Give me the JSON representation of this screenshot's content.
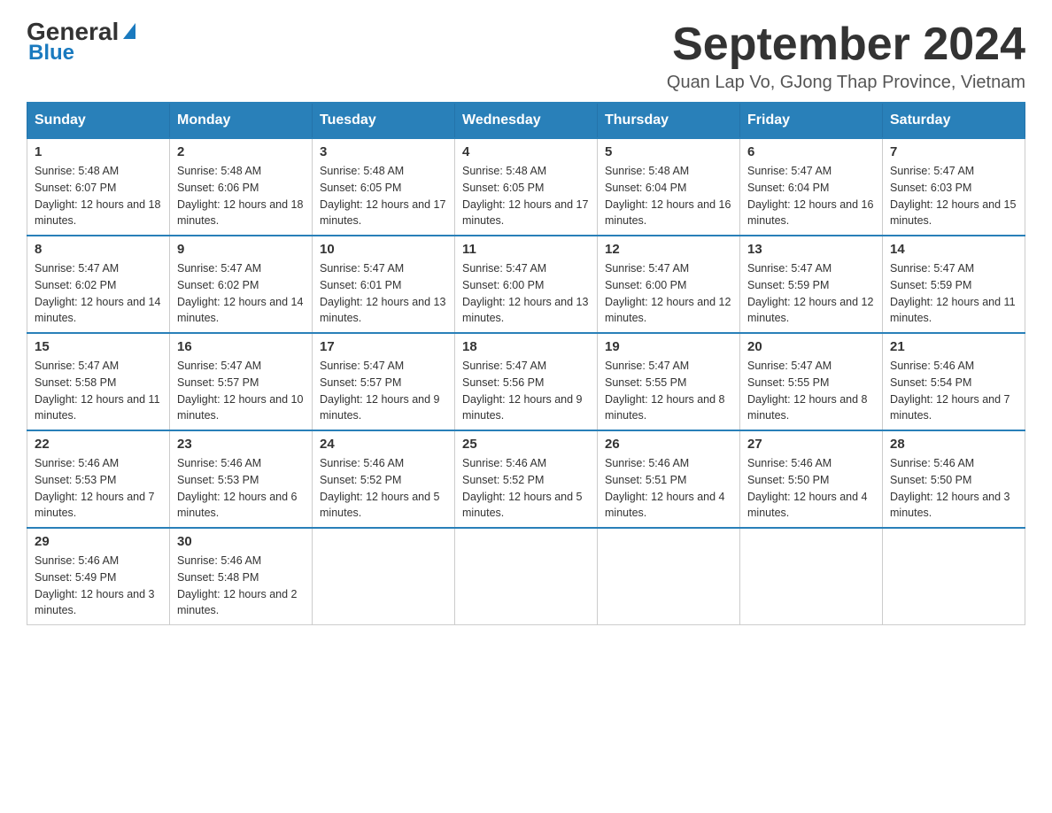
{
  "logo": {
    "general": "General",
    "blue": "Blue"
  },
  "header": {
    "month_year": "September 2024",
    "location": "Quan Lap Vo, GJong Thap Province, Vietnam"
  },
  "days_of_week": [
    "Sunday",
    "Monday",
    "Tuesday",
    "Wednesday",
    "Thursday",
    "Friday",
    "Saturday"
  ],
  "weeks": [
    [
      {
        "day": 1,
        "sunrise": "5:48 AM",
        "sunset": "6:07 PM",
        "daylight": "12 hours and 18 minutes."
      },
      {
        "day": 2,
        "sunrise": "5:48 AM",
        "sunset": "6:06 PM",
        "daylight": "12 hours and 18 minutes."
      },
      {
        "day": 3,
        "sunrise": "5:48 AM",
        "sunset": "6:05 PM",
        "daylight": "12 hours and 17 minutes."
      },
      {
        "day": 4,
        "sunrise": "5:48 AM",
        "sunset": "6:05 PM",
        "daylight": "12 hours and 17 minutes."
      },
      {
        "day": 5,
        "sunrise": "5:48 AM",
        "sunset": "6:04 PM",
        "daylight": "12 hours and 16 minutes."
      },
      {
        "day": 6,
        "sunrise": "5:47 AM",
        "sunset": "6:04 PM",
        "daylight": "12 hours and 16 minutes."
      },
      {
        "day": 7,
        "sunrise": "5:47 AM",
        "sunset": "6:03 PM",
        "daylight": "12 hours and 15 minutes."
      }
    ],
    [
      {
        "day": 8,
        "sunrise": "5:47 AM",
        "sunset": "6:02 PM",
        "daylight": "12 hours and 14 minutes."
      },
      {
        "day": 9,
        "sunrise": "5:47 AM",
        "sunset": "6:02 PM",
        "daylight": "12 hours and 14 minutes."
      },
      {
        "day": 10,
        "sunrise": "5:47 AM",
        "sunset": "6:01 PM",
        "daylight": "12 hours and 13 minutes."
      },
      {
        "day": 11,
        "sunrise": "5:47 AM",
        "sunset": "6:00 PM",
        "daylight": "12 hours and 13 minutes."
      },
      {
        "day": 12,
        "sunrise": "5:47 AM",
        "sunset": "6:00 PM",
        "daylight": "12 hours and 12 minutes."
      },
      {
        "day": 13,
        "sunrise": "5:47 AM",
        "sunset": "5:59 PM",
        "daylight": "12 hours and 12 minutes."
      },
      {
        "day": 14,
        "sunrise": "5:47 AM",
        "sunset": "5:59 PM",
        "daylight": "12 hours and 11 minutes."
      }
    ],
    [
      {
        "day": 15,
        "sunrise": "5:47 AM",
        "sunset": "5:58 PM",
        "daylight": "12 hours and 11 minutes."
      },
      {
        "day": 16,
        "sunrise": "5:47 AM",
        "sunset": "5:57 PM",
        "daylight": "12 hours and 10 minutes."
      },
      {
        "day": 17,
        "sunrise": "5:47 AM",
        "sunset": "5:57 PM",
        "daylight": "12 hours and 9 minutes."
      },
      {
        "day": 18,
        "sunrise": "5:47 AM",
        "sunset": "5:56 PM",
        "daylight": "12 hours and 9 minutes."
      },
      {
        "day": 19,
        "sunrise": "5:47 AM",
        "sunset": "5:55 PM",
        "daylight": "12 hours and 8 minutes."
      },
      {
        "day": 20,
        "sunrise": "5:47 AM",
        "sunset": "5:55 PM",
        "daylight": "12 hours and 8 minutes."
      },
      {
        "day": 21,
        "sunrise": "5:46 AM",
        "sunset": "5:54 PM",
        "daylight": "12 hours and 7 minutes."
      }
    ],
    [
      {
        "day": 22,
        "sunrise": "5:46 AM",
        "sunset": "5:53 PM",
        "daylight": "12 hours and 7 minutes."
      },
      {
        "day": 23,
        "sunrise": "5:46 AM",
        "sunset": "5:53 PM",
        "daylight": "12 hours and 6 minutes."
      },
      {
        "day": 24,
        "sunrise": "5:46 AM",
        "sunset": "5:52 PM",
        "daylight": "12 hours and 5 minutes."
      },
      {
        "day": 25,
        "sunrise": "5:46 AM",
        "sunset": "5:52 PM",
        "daylight": "12 hours and 5 minutes."
      },
      {
        "day": 26,
        "sunrise": "5:46 AM",
        "sunset": "5:51 PM",
        "daylight": "12 hours and 4 minutes."
      },
      {
        "day": 27,
        "sunrise": "5:46 AM",
        "sunset": "5:50 PM",
        "daylight": "12 hours and 4 minutes."
      },
      {
        "day": 28,
        "sunrise": "5:46 AM",
        "sunset": "5:50 PM",
        "daylight": "12 hours and 3 minutes."
      }
    ],
    [
      {
        "day": 29,
        "sunrise": "5:46 AM",
        "sunset": "5:49 PM",
        "daylight": "12 hours and 3 minutes."
      },
      {
        "day": 30,
        "sunrise": "5:46 AM",
        "sunset": "5:48 PM",
        "daylight": "12 hours and 2 minutes."
      },
      null,
      null,
      null,
      null,
      null
    ]
  ]
}
